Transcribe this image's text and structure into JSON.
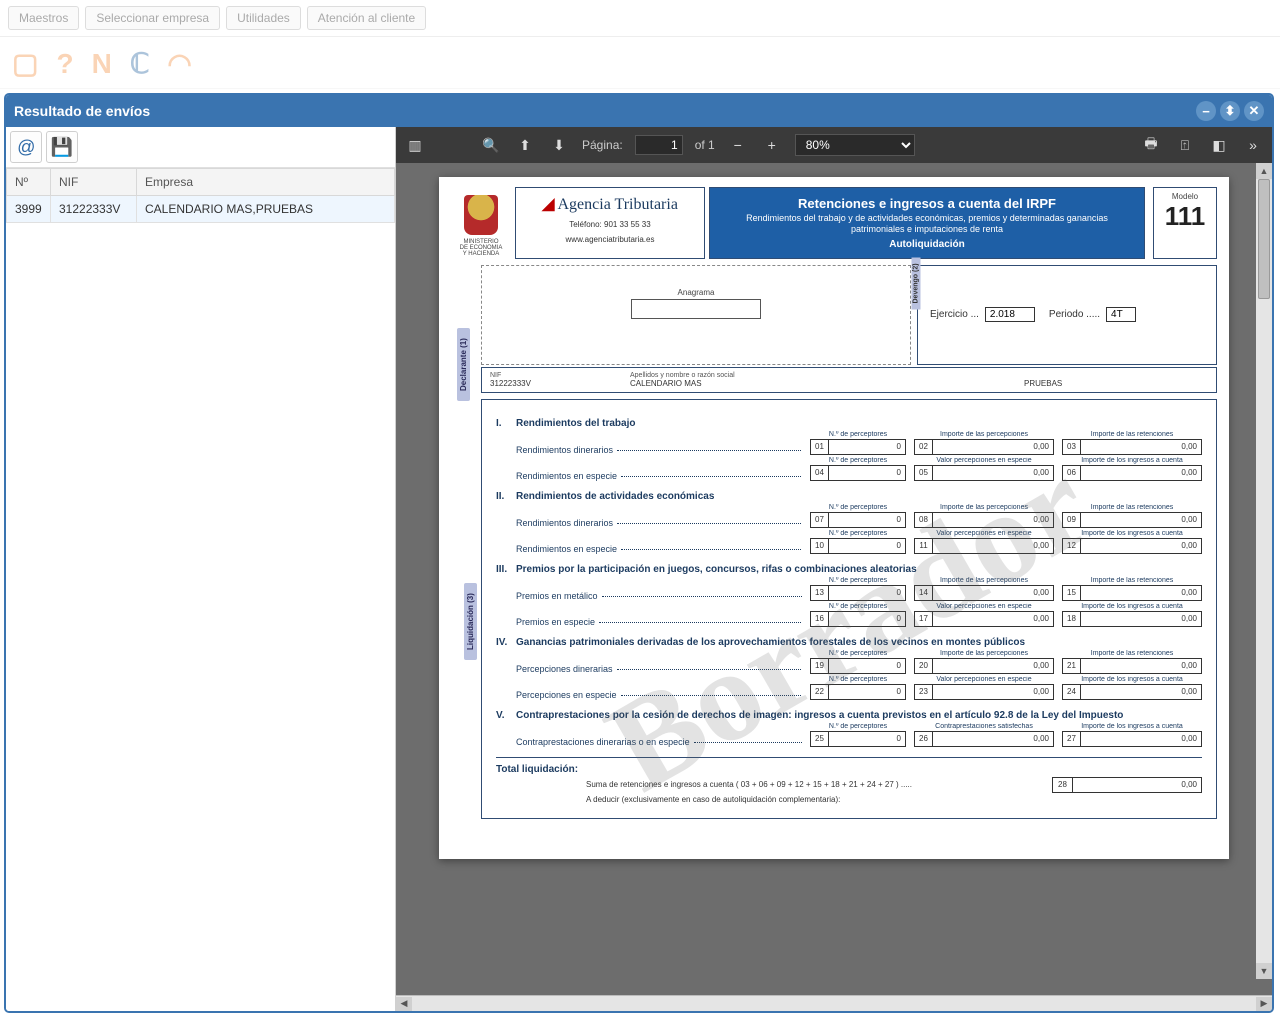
{
  "menu": {
    "items": [
      "Maestros",
      "Seleccionar empresa",
      "Utilidades",
      "Atención al cliente"
    ]
  },
  "window": {
    "title": "Resultado de envíos"
  },
  "list": {
    "headers": [
      "Nº",
      "NIF",
      "Empresa"
    ],
    "rows": [
      {
        "num": "3999",
        "nif": "31222333V",
        "empresa": "CALENDARIO MAS,PRUEBAS"
      }
    ]
  },
  "pdf": {
    "page_label": "Página:",
    "page_current": "1",
    "page_of": "of 1",
    "zoom": "80%"
  },
  "doc": {
    "ministerio": "MINISTERIO\nDE ECONOMIA\nY HACIENDA",
    "agencia_name": "Agencia Tributaria",
    "agencia_tel": "Teléfono: 901 33 55 33",
    "agencia_web": "www.agenciatributaria.es",
    "blue_title": "Retenciones e ingresos a cuenta del IRPF",
    "blue_sub": "Rendimientos del trabajo y de actividades económicas, premios y determinadas ganancias patrimoniales e imputaciones de renta",
    "blue_foot": "Autoliquidación",
    "modelo_label": "Modelo",
    "modelo_num": "111",
    "anagrama": "Anagrama",
    "declarante_tab": "Declarante (1)",
    "devengo_tab": "Devengo (2)",
    "liquidacion_tab": "Liquidación (3)",
    "ejercicio_label": "Ejercicio ...",
    "ejercicio": "2.018",
    "periodo_label": "Periodo .....",
    "periodo": "4T",
    "nif_label": "NIF",
    "nif": "31222333V",
    "apell_label": "Apellidos y nombre o razón social",
    "apell1": "CALENDARIO MAS",
    "apell2": "PRUEBAS",
    "watermark": "Borrador",
    "headers": {
      "perceptores": "N.º de perceptores",
      "percepciones": "Importe de las percepciones",
      "retenciones": "Importe de las retenciones",
      "valor_especie": "Valor percepciones en especie",
      "ingresos_cta": "Importe de los ingresos a cuenta",
      "contraprest": "Contraprestaciones satisfechas"
    },
    "sections": [
      {
        "num": "I.",
        "title": "Rendimientos del trabajo",
        "rows": [
          {
            "desc": "Rendimientos dinerarios",
            "cells": [
              [
                "01",
                "0",
                "perceptores"
              ],
              [
                "02",
                "0,00",
                "percepciones"
              ],
              [
                "03",
                "0,00",
                "retenciones"
              ]
            ]
          },
          {
            "desc": "Rendimientos en especie",
            "cells": [
              [
                "04",
                "0",
                "perceptores"
              ],
              [
                "05",
                "0,00",
                "valor_especie"
              ],
              [
                "06",
                "0,00",
                "ingresos_cta"
              ]
            ]
          }
        ]
      },
      {
        "num": "II.",
        "title": "Rendimientos de actividades económicas",
        "rows": [
          {
            "desc": "Rendimientos dinerarios",
            "cells": [
              [
                "07",
                "0",
                "perceptores"
              ],
              [
                "08",
                "0,00",
                "percepciones"
              ],
              [
                "09",
                "0,00",
                "retenciones"
              ]
            ]
          },
          {
            "desc": "Rendimientos en especie",
            "cells": [
              [
                "10",
                "0",
                "perceptores"
              ],
              [
                "11",
                "0,00",
                "valor_especie"
              ],
              [
                "12",
                "0,00",
                "ingresos_cta"
              ]
            ]
          }
        ]
      },
      {
        "num": "III.",
        "title": "Premios por la participación en juegos, concursos, rifas o combinaciones aleatorias",
        "rows": [
          {
            "desc": "Premios en metálico",
            "cells": [
              [
                "13",
                "0",
                "perceptores"
              ],
              [
                "14",
                "0,00",
                "percepciones"
              ],
              [
                "15",
                "0,00",
                "retenciones"
              ]
            ]
          },
          {
            "desc": "Premios en especie",
            "cells": [
              [
                "16",
                "0",
                "perceptores"
              ],
              [
                "17",
                "0,00",
                "valor_especie"
              ],
              [
                "18",
                "0,00",
                "ingresos_cta"
              ]
            ]
          }
        ]
      },
      {
        "num": "IV.",
        "title": "Ganancias patrimoniales derivadas de los aprovechamientos forestales de los vecinos en montes públicos",
        "rows": [
          {
            "desc": "Percepciones dinerarias",
            "cells": [
              [
                "19",
                "0",
                "perceptores"
              ],
              [
                "20",
                "0,00",
                "percepciones"
              ],
              [
                "21",
                "0,00",
                "retenciones"
              ]
            ]
          },
          {
            "desc": "Percepciones en especie",
            "cells": [
              [
                "22",
                "0",
                "perceptores"
              ],
              [
                "23",
                "0,00",
                "valor_especie"
              ],
              [
                "24",
                "0,00",
                "ingresos_cta"
              ]
            ]
          }
        ]
      },
      {
        "num": "V.",
        "title": "Contraprestaciones por la cesión de derechos de imagen: ingresos a cuenta previstos en el artículo 92.8 de la Ley del Impuesto",
        "rows": [
          {
            "desc": "Contraprestaciones dinerarias o en especie",
            "cells": [
              [
                "25",
                "0",
                "perceptores"
              ],
              [
                "26",
                "0,00",
                "contraprest"
              ],
              [
                "27",
                "0,00",
                "ingresos_cta"
              ]
            ]
          }
        ]
      }
    ],
    "total": {
      "title": "Total liquidación:",
      "suma_label": "Suma de retenciones e ingresos a cuenta ( 03 + 06 + 09 + 12 + 15 + 18 + 21 + 24 + 27 ) .....",
      "box": [
        "28",
        "0,00"
      ],
      "deducir": "A deducir (exclusivamente en caso de autoliquidación complementaria):"
    }
  }
}
